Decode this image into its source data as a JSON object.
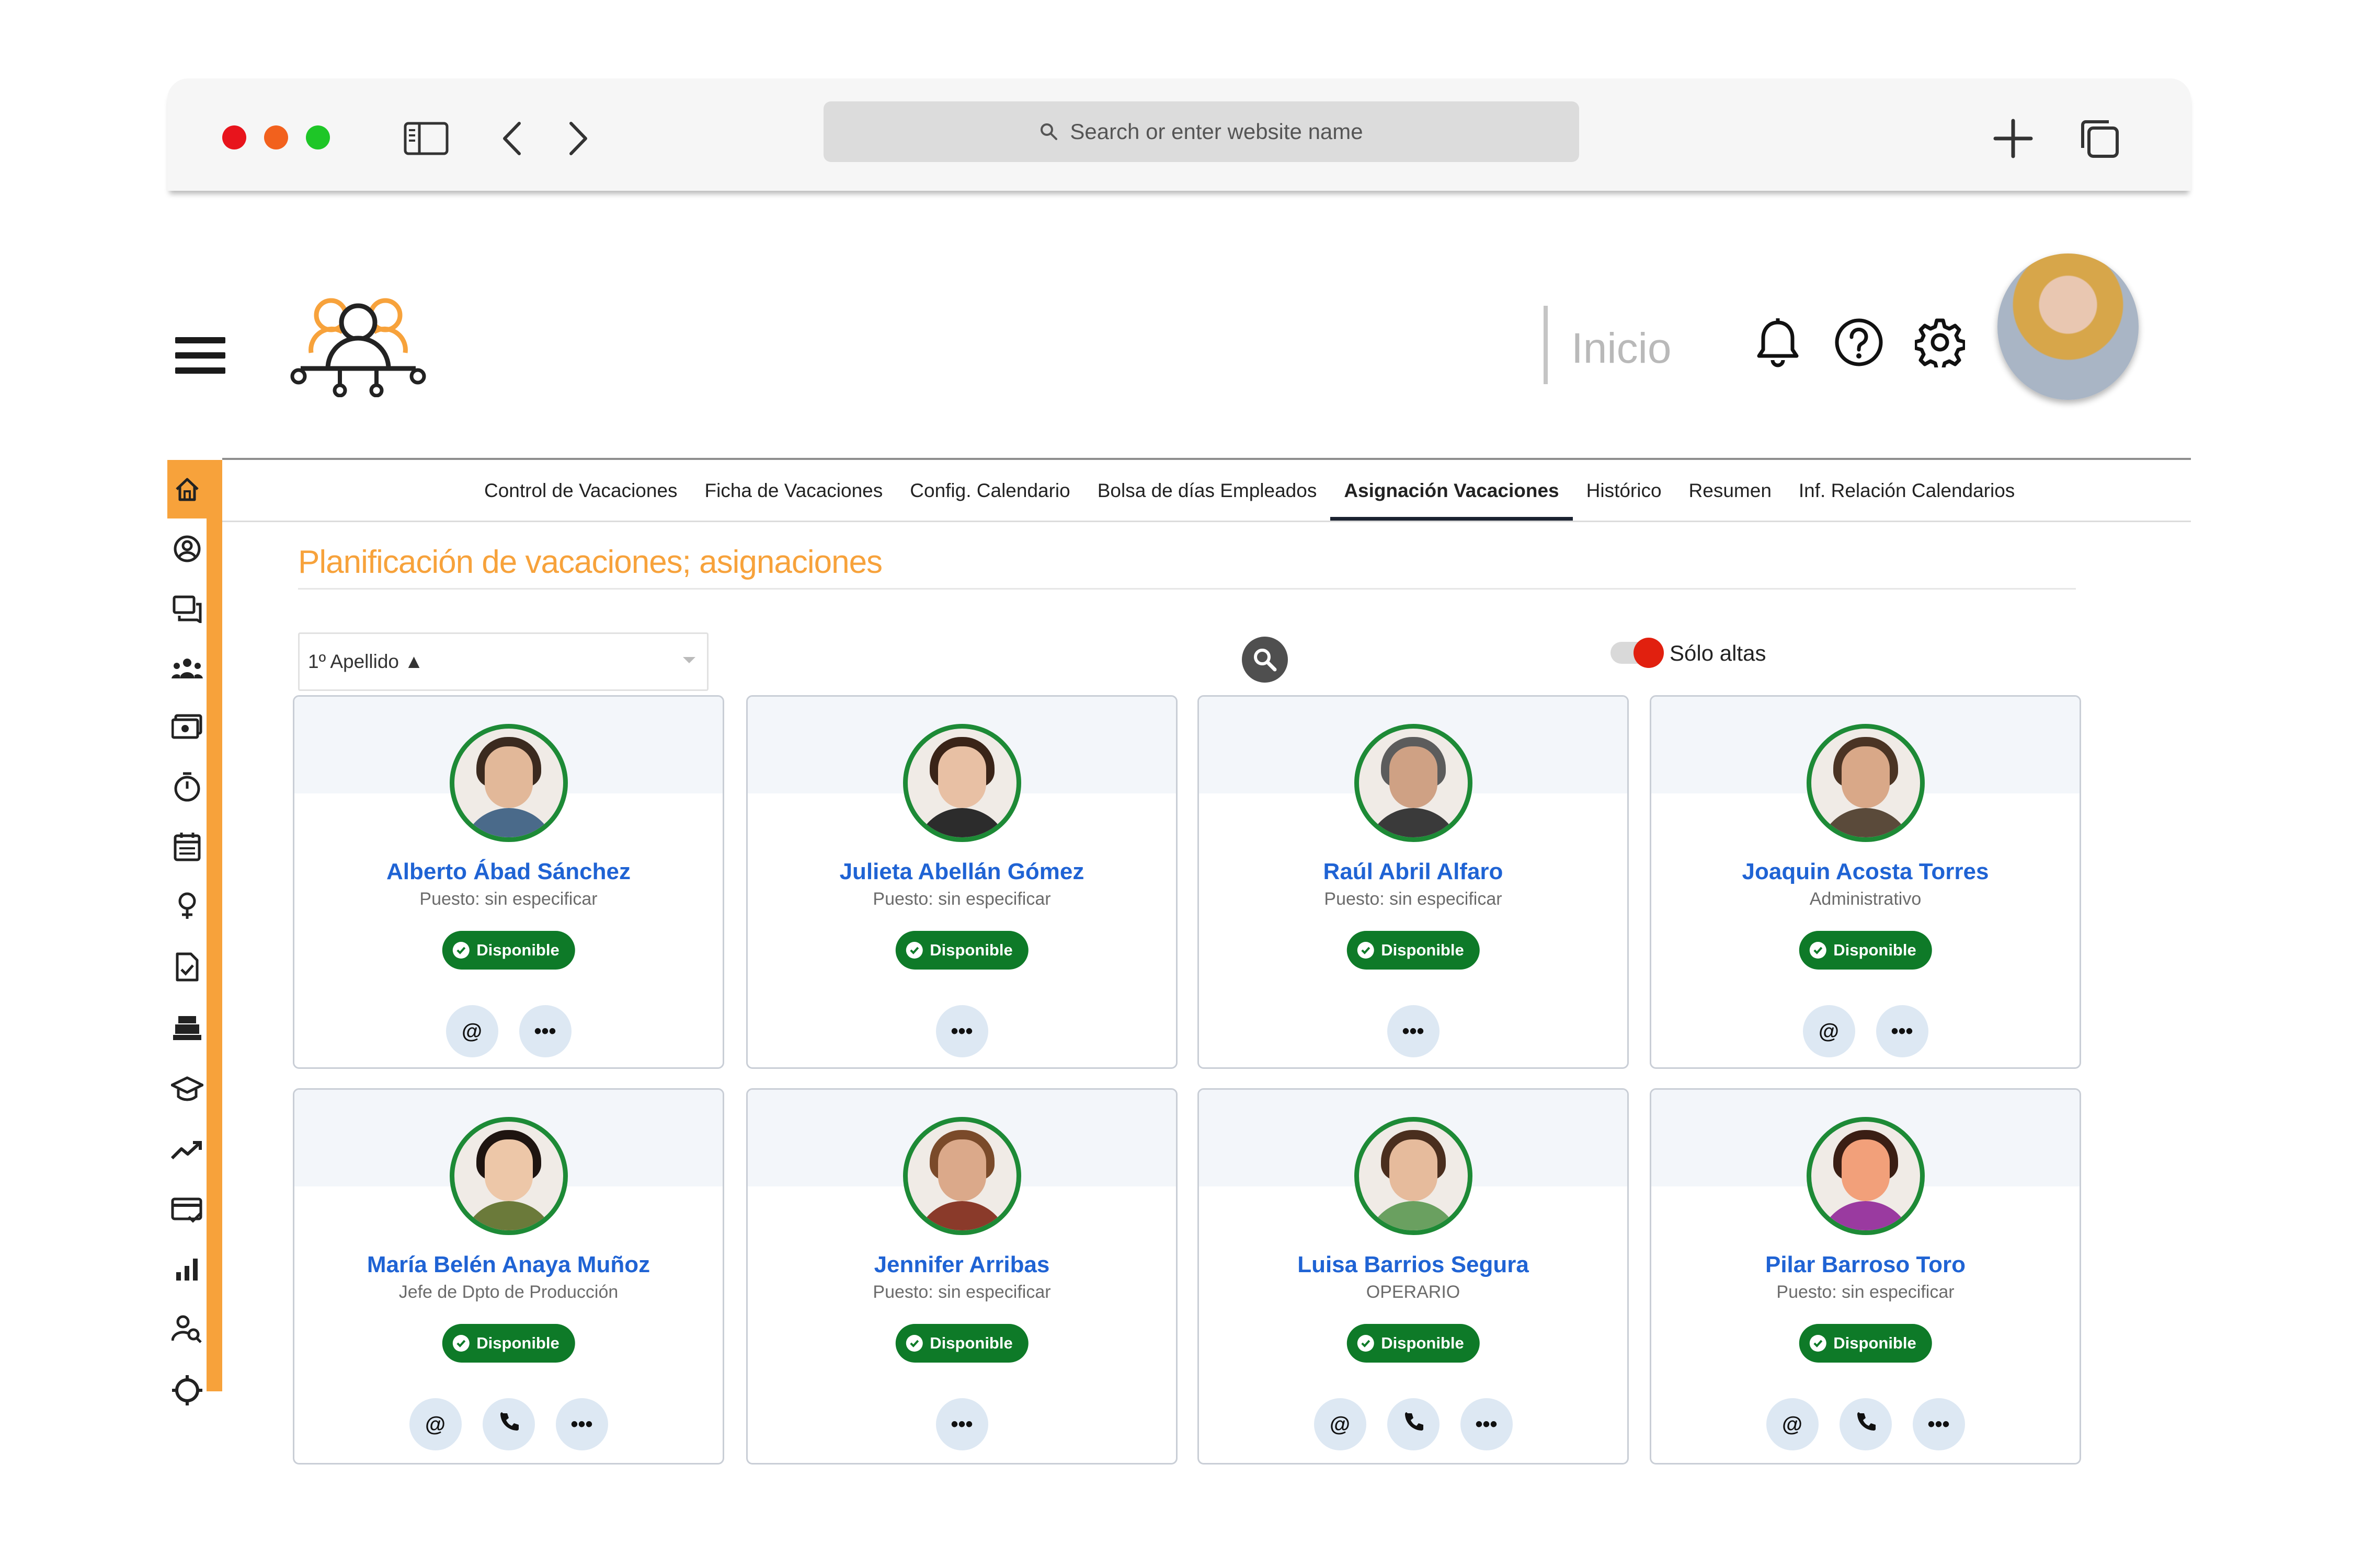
{
  "browser": {
    "url_placeholder": "Search or enter website name"
  },
  "header": {
    "breadcrumb": "Inicio"
  },
  "tabs": [
    {
      "label": "Control de Vacaciones",
      "active": false
    },
    {
      "label": "Ficha de Vacaciones",
      "active": false
    },
    {
      "label": "Config. Calendario",
      "active": false
    },
    {
      "label": "Bolsa de días Empleados",
      "active": false
    },
    {
      "label": "Asignación Vacaciones",
      "active": true
    },
    {
      "label": "Histórico",
      "active": false
    },
    {
      "label": "Resumen",
      "active": false
    },
    {
      "label": "Inf. Relación Calendarios",
      "active": false
    }
  ],
  "page": {
    "title": "Planificación de vacaciones; asignaciones",
    "sort_value": "1º Apellido ▲",
    "toggle_label": "Sólo altas",
    "toggle_on": true
  },
  "colors": {
    "accent": "#f7a23b",
    "name_link": "#1f63d4",
    "status_green": "#0e7a28",
    "toggle_red": "#e1200f"
  },
  "rail_icons": [
    "home-icon",
    "user-circle-icon",
    "chat-icon",
    "team-icon",
    "payroll-icon",
    "timer-icon",
    "calendar-icon",
    "location-icon",
    "document-check-icon",
    "register-icon",
    "graduation-icon",
    "trend-icon",
    "card-icon",
    "bar-chart-icon",
    "user-search-icon",
    "crosshair-icon"
  ],
  "employees": [
    {
      "name": "Alberto Ábad Sánchez",
      "role": "Puesto: sin especificar",
      "status": "Disponible",
      "actions": [
        "email",
        "more"
      ]
    },
    {
      "name": "Julieta Abellán Gómez",
      "role": "Puesto: sin especificar",
      "status": "Disponible",
      "actions": [
        "more"
      ]
    },
    {
      "name": "Raúl Abril Alfaro",
      "role": "Puesto: sin especificar",
      "status": "Disponible",
      "actions": [
        "more"
      ]
    },
    {
      "name": "Joaquin Acosta Torres",
      "role": "Administrativo",
      "status": "Disponible",
      "actions": [
        "email",
        "more"
      ]
    },
    {
      "name": "María Belén Anaya Muñoz",
      "role": "Jefe de Dpto de Producción",
      "status": "Disponible",
      "actions": [
        "email",
        "phone",
        "more"
      ]
    },
    {
      "name": "Jennifer Arribas",
      "role": "Puesto: sin especificar",
      "status": "Disponible",
      "actions": [
        "more"
      ]
    },
    {
      "name": "Luisa Barrios Segura",
      "role": "OPERARIO",
      "status": "Disponible",
      "actions": [
        "email",
        "phone",
        "more"
      ]
    },
    {
      "name": "Pilar Barroso Toro",
      "role": "Puesto: sin especificar",
      "status": "Disponible",
      "actions": [
        "email",
        "phone",
        "more"
      ]
    }
  ]
}
